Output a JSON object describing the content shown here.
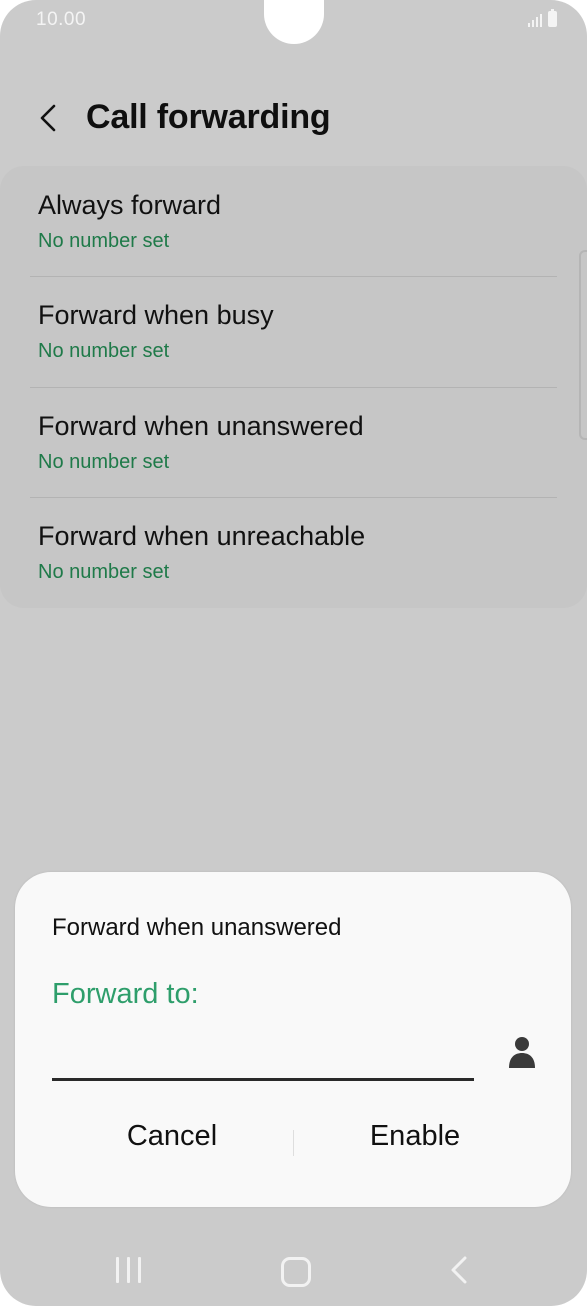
{
  "status_bar": {
    "time": "10.00"
  },
  "header": {
    "title": "Call forwarding"
  },
  "settings": {
    "items": [
      {
        "title": "Always forward",
        "subtitle": "No number set"
      },
      {
        "title": "Forward when busy",
        "subtitle": "No number set"
      },
      {
        "title": "Forward when unanswered",
        "subtitle": "No number set"
      },
      {
        "title": "Forward when unreachable",
        "subtitle": "No number set"
      }
    ]
  },
  "dialog": {
    "title": "Forward when unanswered",
    "field_label": "Forward to:",
    "input_value": "",
    "cancel_label": "Cancel",
    "enable_label": "Enable"
  },
  "colors": {
    "accent_green": "#2e9e6b",
    "subtitle_green": "#1f7a49",
    "scrim": "#cbcbcb"
  },
  "icons": {
    "back": "chevron-left-icon",
    "contact": "person-icon",
    "nav_recent": "recent-apps-icon",
    "nav_home": "home-icon",
    "nav_back": "back-icon"
  }
}
